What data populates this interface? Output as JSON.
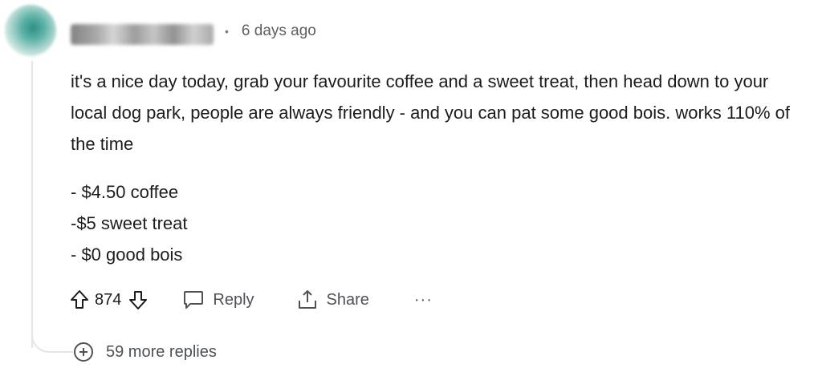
{
  "comment": {
    "timestamp": "6 days ago",
    "separator": "•",
    "paragraph": "it's a nice day today, grab your favourite coffee and a sweet treat, then head down to your local dog park, people are always friendly - and you can pat some good bois. works 110% of the time",
    "list": [
      "- $4.50 coffee",
      "-$5 sweet treat",
      "- $0 good bois"
    ]
  },
  "actions": {
    "vote_count": "874",
    "reply_label": "Reply",
    "share_label": "Share",
    "more_label": "···"
  },
  "more_replies_label": "59 more replies",
  "colors": {
    "text": "#1c1c1c",
    "muted": "#5b5f63",
    "thread_line": "#e3e5e8"
  }
}
